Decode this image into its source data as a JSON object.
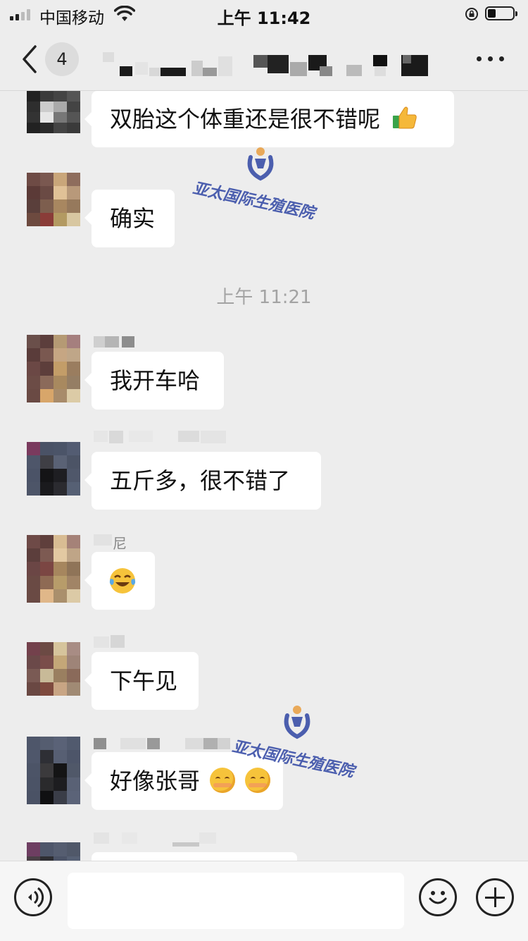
{
  "status_bar": {
    "carrier": "中国移动",
    "time": "上午 11:42"
  },
  "nav": {
    "unread_count": "4",
    "back_icon": "chevron-left-icon",
    "more_icon": "more-icon"
  },
  "watermark": {
    "text": "亚太国际生殖医院",
    "color": "#3a4fa8"
  },
  "colors": {
    "background": "#ededed",
    "bubble": "#ffffff",
    "timestamp": "#a3a3a3"
  },
  "messages": [
    {
      "text": "双胎这个体重还是很不错呢",
      "emoji": "thumbs-up"
    },
    {
      "sender": "",
      "text": "确实"
    },
    {
      "type": "time",
      "text": "上午 11:21"
    },
    {
      "sender": "",
      "text": "我开车哈"
    },
    {
      "sender": "",
      "text": "五斤多，很不错了"
    },
    {
      "sender": "尼",
      "emoji": "laughing-crying"
    },
    {
      "sender": "",
      "text": "下午见"
    },
    {
      "sender": "",
      "text": "好像张哥",
      "emoji": [
        "blushing",
        "blushing"
      ]
    }
  ],
  "input": {
    "value": "",
    "voice_icon": "voice-icon",
    "emoji_icon": "smile-icon",
    "plus_icon": "plus-icon"
  }
}
